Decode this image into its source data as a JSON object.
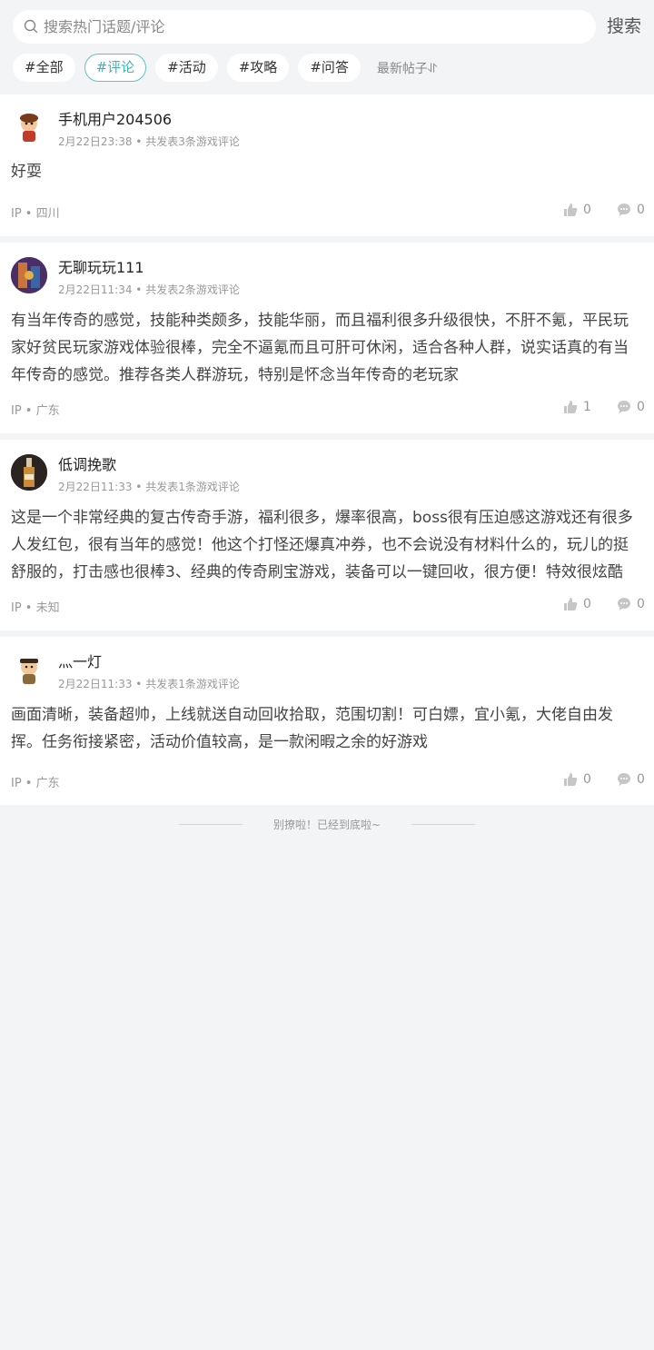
{
  "search": {
    "placeholder": "搜索热门话题/评论",
    "button": "搜索"
  },
  "tabs": [
    {
      "label": "#全部",
      "active": false
    },
    {
      "label": "#评论",
      "active": true
    },
    {
      "label": "#活动",
      "active": false
    },
    {
      "label": "#攻略",
      "active": false
    },
    {
      "label": "#问答",
      "active": false
    }
  ],
  "sort_label": "最新帖子⥯",
  "posts": [
    {
      "username": "手机用户204506",
      "meta": "2月22日23:38 • 共发表3条游戏评论",
      "content": "好耍",
      "ip": "IP • 四川",
      "likes": "0",
      "comments": "0"
    },
    {
      "username": "无聊玩玩111",
      "meta": "2月22日11:34 • 共发表2条游戏评论",
      "content": "有当年传奇的感觉，技能种类颇多，技能华丽，而且福利很多升级很快，不肝不氪，平民玩家好贫民玩家游戏体验很棒，完全不逼氪而且可肝可休闲，适合各种人群，说实话真的有当年传奇的感觉。推荐各类人群游玩，特别是怀念当年传奇的老玩家",
      "ip": "IP • 广东",
      "likes": "1",
      "comments": "0"
    },
    {
      "username": "低调挽歌",
      "meta": "2月22日11:33 • 共发表1条游戏评论",
      "content": "这是一个非常经典的复古传奇手游，福利很多，爆率很高，boss很有压迫感这游戏还有很多人发红包，很有当年的感觉！他这个打怪还爆真冲券，也不会说没有材料什么的，玩儿的挺舒服的，打击感也很棒3、经典的传奇刷宝游戏，装备可以一键回收，很方便！特效很炫酷",
      "ip": "IP • 未知",
      "likes": "0",
      "comments": "0"
    },
    {
      "username": "灬一灯",
      "meta": "2月22日11:33 • 共发表1条游戏评论",
      "content": "画面清晰，装备超帅，上线就送自动回收拾取，范围切割！可白嫖，宜小氪，大佬自由发挥。任务衔接紧密，活动价值较高，是一款闲暇之余的好游戏",
      "ip": "IP • 广东",
      "likes": "0",
      "comments": "0"
    }
  ],
  "footer_text": "别撩啦！已经到底啦~"
}
